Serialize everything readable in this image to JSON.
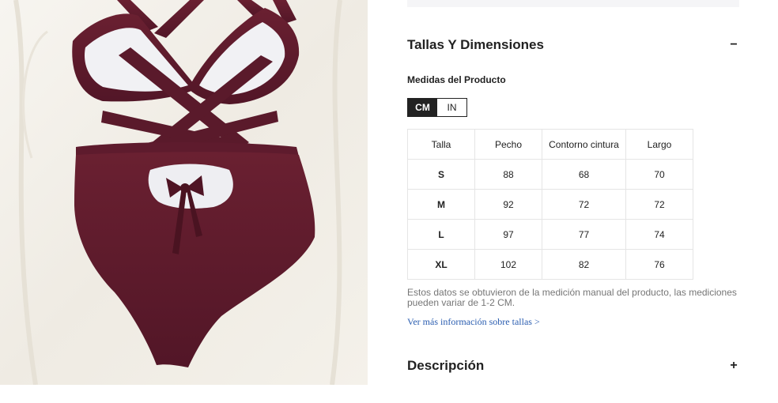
{
  "product": {
    "image_alt": "Bañador burdeos con tiras cruzadas en la espalda",
    "colors": {
      "swimsuit": "#5e1a2c",
      "swimsuit_shadow": "#4a1321",
      "lining": "#ffffff",
      "backdrop": "#f2efe8"
    }
  },
  "size_section": {
    "title": "Tallas Y Dimensiones",
    "toggle_symbol": "−",
    "subtitle": "Medidas del Producto",
    "units": [
      {
        "label": "CM",
        "active": true
      },
      {
        "label": "IN",
        "active": false
      }
    ],
    "table": {
      "headers": [
        "Talla",
        "Pecho",
        "Contorno cintura",
        "Largo"
      ],
      "rows": [
        {
          "size": "S",
          "pecho": "88",
          "cintura": "68",
          "largo": "70"
        },
        {
          "size": "M",
          "pecho": "92",
          "cintura": "72",
          "largo": "72"
        },
        {
          "size": "L",
          "pecho": "97",
          "cintura": "77",
          "largo": "74"
        },
        {
          "size": "XL",
          "pecho": "102",
          "cintura": "82",
          "largo": "76"
        }
      ]
    },
    "note": "Estos datos se obtuvieron de la medición manual del producto, las mediciones pueden variar de 1-2 CM.",
    "more_link": "Ver más información sobre tallas >"
  },
  "description_section": {
    "title": "Descripción",
    "toggle_symbol": "+"
  }
}
